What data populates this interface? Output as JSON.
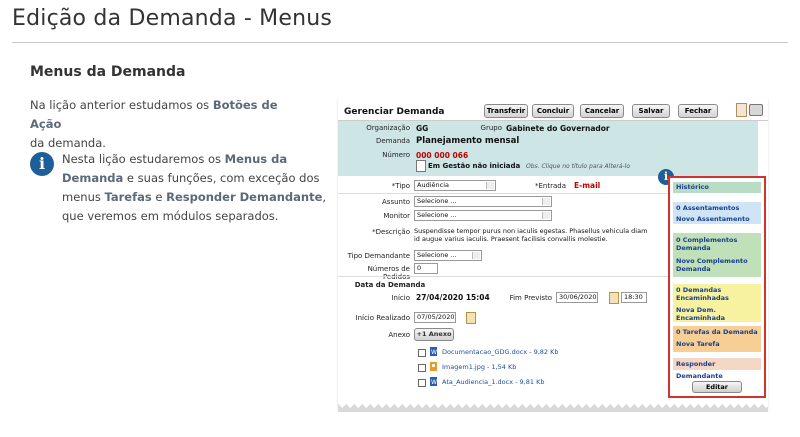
{
  "page": {
    "title": "Edição da Demanda - Menus"
  },
  "lesson": {
    "heading": "Menus da Demanda",
    "p1_a": "Na lição anterior estudamos os ",
    "p1_hl": "Botões de Ação",
    "p1_b": " da demanda.",
    "p2_a": "Nesta lição estudaremos os ",
    "p2_hl1": "Menus da Demanda",
    "p2_b": " e suas funções, com exceção dos menus ",
    "p2_hl2": "Tarefas",
    "p2_c": " e ",
    "p2_hl3": "Responder Demandante",
    "p2_d": ", que veremos em módulos separados.",
    "info_icon": "i"
  },
  "shot": {
    "title": "Gerenciar Demanda",
    "toolbar": [
      "Transferir",
      "Concluir",
      "Cancelar",
      "Salvar",
      "Fechar"
    ],
    "header": {
      "organizacao_label": "Organização",
      "organizacao": "GG",
      "grupo_label": "Grupo",
      "grupo": "Gabinete do Governador",
      "demanda_label": "Demanda",
      "demanda": "Planejamento mensal",
      "numero_label": "Número",
      "numero": "000 000 066",
      "status": "Em Gestão não iniciada",
      "obs": "Obs. Clique no título para Alterá-lo"
    },
    "form": {
      "tipo_label": "*Tipo",
      "tipo": "Audiência",
      "entrada_label": "*Entrada",
      "entrada": "E-mail",
      "assunto_label": "Assunto",
      "assunto": "Selecione ...",
      "monitor_label": "Monitor",
      "monitor": "Selecione ...",
      "descricao_label": "*Descrição",
      "descricao": "Suspendisse tempor purus non iaculis egestas. Phasellus vehicula diam id augue varius iaculis. Praesent facilisis convallis molestie.",
      "tipo_dem_label": "Tipo Demandante",
      "tipo_dem": "Selecione ...",
      "pedidos_label": "Números de Pedidos",
      "pedidos": "0",
      "data_label": "Data da Demanda",
      "inicio_label": "Início",
      "inicio": "27/04/2020 15:04",
      "fim_label": "Fim Previsto",
      "fim_data": "30/06/2020",
      "fim_hora": "18:30",
      "inicio_real_label": "Início Realizado",
      "inicio_real": "07/05/2020",
      "anexo_label": "Anexo",
      "anexo_btn": "+1 Anexo",
      "anexos": [
        "Documentacao_GDG.docx - 9,82 Kb",
        "Imagem1.jpg - 1,54 Kb",
        "Ata_Audiencia_1.docx - 9,81 Kb"
      ]
    },
    "menu": {
      "historico": "Histórico",
      "assent_count": "0 Assentamentos",
      "assent_new": "Novo Assentamento",
      "comp_count": "0 Complementos Demanda",
      "comp_new": "Novo Complemento Demanda",
      "enc_count": "0 Demandas Encaminhadas",
      "enc_new": "Nova Dem. Encaminhada",
      "tar_count": "0 Tarefas da Demanda",
      "tar_new": "Nova Tarefa",
      "responder": "Responder Demandante",
      "editar": "Editar"
    }
  }
}
